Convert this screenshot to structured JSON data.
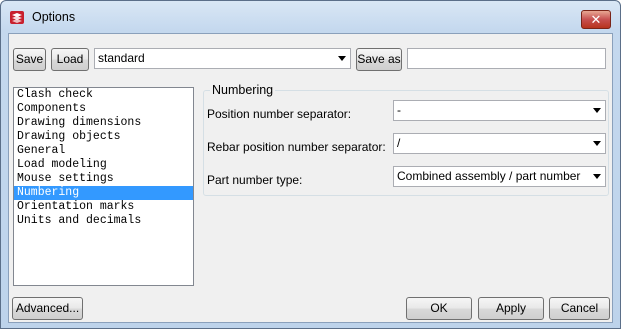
{
  "window": {
    "title": "Options",
    "close_label": "✕"
  },
  "toolbar": {
    "save_label": "Save",
    "load_label": "Load",
    "settings_value": "standard",
    "save_as_label": "Save as",
    "save_as_value": ""
  },
  "categories": {
    "items": [
      {
        "label": "Clash check"
      },
      {
        "label": "Components"
      },
      {
        "label": "Drawing dimensions"
      },
      {
        "label": "Drawing objects"
      },
      {
        "label": "General"
      },
      {
        "label": "Load modeling"
      },
      {
        "label": "Mouse settings"
      },
      {
        "label": "Numbering"
      },
      {
        "label": "Orientation marks"
      },
      {
        "label": "Units and decimals"
      }
    ],
    "selected": "Numbering"
  },
  "numbering": {
    "group_title": "Numbering",
    "position_separator_label": "Position number separator:",
    "position_separator_value": "-",
    "rebar_separator_label": "Rebar position number separator:",
    "rebar_separator_value": "/",
    "part_type_label": "Part number type:",
    "part_type_value": "Combined assembly / part number"
  },
  "footer": {
    "advanced_label": "Advanced...",
    "ok_label": "OK",
    "apply_label": "Apply",
    "cancel_label": "Cancel"
  },
  "colors": {
    "selection": "#3399ff",
    "close_button": "#c75050"
  }
}
